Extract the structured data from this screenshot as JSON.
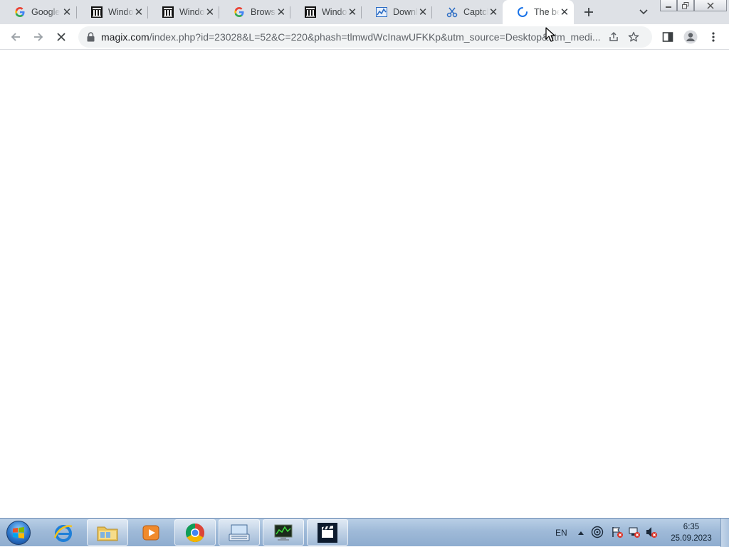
{
  "tabs": [
    {
      "title": "Google",
      "favicon": "google-g-icon",
      "active": false
    },
    {
      "title": "Windows",
      "favicon": "archive-building-icon",
      "active": false
    },
    {
      "title": "Windows",
      "favicon": "archive-building-icon",
      "active": false
    },
    {
      "title": "Browser",
      "favicon": "google-g-icon",
      "active": false
    },
    {
      "title": "Windows",
      "favicon": "archive-building-icon",
      "active": false
    },
    {
      "title": "Download",
      "favicon": "chart-page-icon",
      "active": false
    },
    {
      "title": "Captcha",
      "favicon": "scissor-logo-icon",
      "active": false
    },
    {
      "title": "The best",
      "favicon": "loading-spinner-icon",
      "active": true
    }
  ],
  "address_bar": {
    "url_host": "magix.com",
    "url_rest": "/index.php?id=23028&L=52&C=220&phash=tlmwdWcInawUFKKp&utm_source=Desktop&utm_medi..."
  },
  "tray": {
    "language": "EN",
    "time": "6:35",
    "date": "25.09.2023"
  },
  "colors": {
    "tabstrip_bg": "#dee1e6",
    "omnibox_bg": "#f1f3f4",
    "spinner_blue": "#1a73e8",
    "taskbar_top": "#b9cfe6"
  }
}
